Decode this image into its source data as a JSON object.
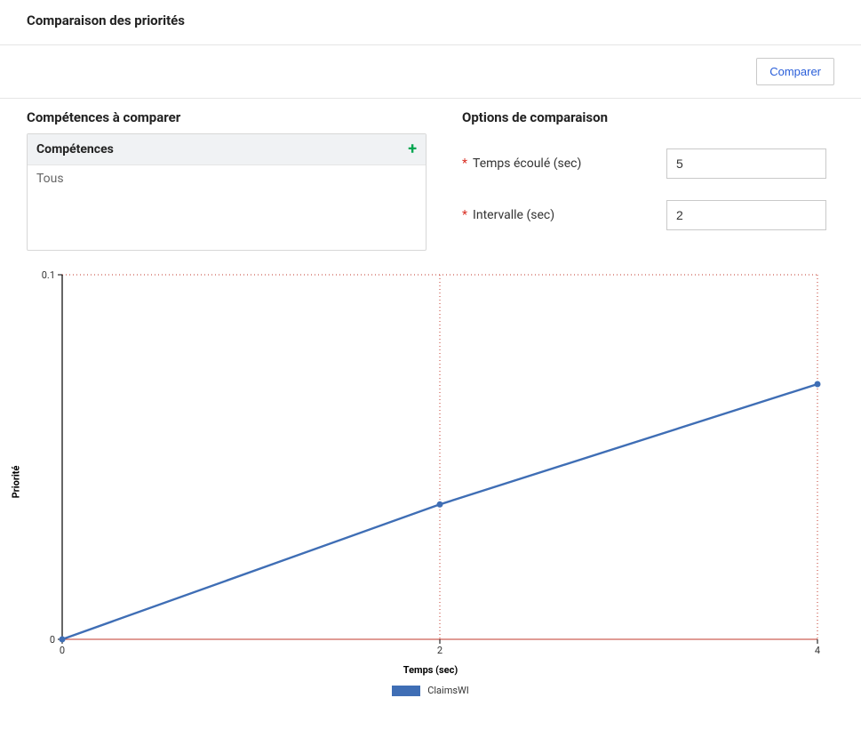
{
  "header": {
    "title": "Comparaison des priorités"
  },
  "actions": {
    "compare": "Comparer"
  },
  "skills": {
    "section_label": "Compétences à comparer",
    "header": "Compétences",
    "items": [
      "Tous"
    ]
  },
  "options": {
    "section_label": "Options de comparaison",
    "elapsed_label": "Temps écoulé (sec)",
    "elapsed_value": "5",
    "interval_label": "Intervalle (sec)",
    "interval_value": "2"
  },
  "chart_data": {
    "type": "line",
    "xlabel": "Temps (sec)",
    "ylabel": "Priorité",
    "xlim": [
      0,
      4
    ],
    "ylim": [
      0,
      0.1
    ],
    "x_ticks": [
      0,
      2,
      4
    ],
    "y_ticks": [
      0,
      0.1
    ],
    "grid": "dotted",
    "series": [
      {
        "name": "ClaimsWI",
        "color": "#3f6eb5",
        "x": [
          0,
          2,
          4
        ],
        "y": [
          0,
          0.037,
          0.07
        ]
      }
    ]
  }
}
